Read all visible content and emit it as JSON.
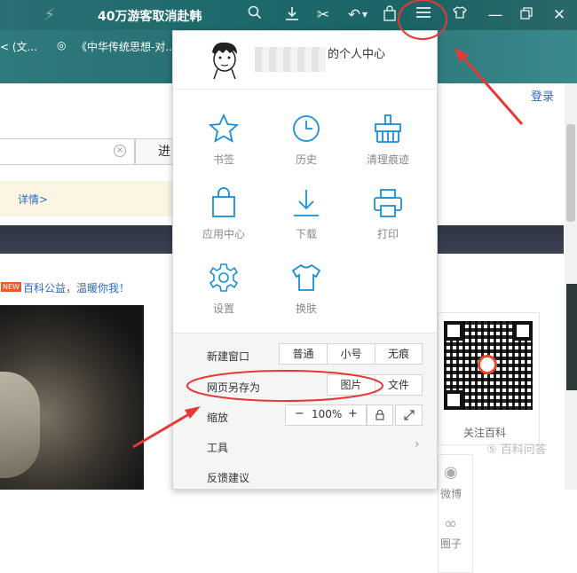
{
  "titlebar": {
    "title": "40万游客取消赴韩"
  },
  "bookmarks": [
    {
      "label": "< (文..."
    },
    {
      "label": "《中华传统思想-对..."
    }
  ],
  "page": {
    "login": "登录",
    "search_button": "进",
    "detail_link": "详情>",
    "new_badge": "NEW",
    "charity_text": "百科公益，温暖你我！",
    "follow_label": "关注百科",
    "side_items": [
      "微博",
      "圈子"
    ],
    "watermark": "⑤ 百科问答"
  },
  "menu": {
    "user_center_text": "的个人中心",
    "grid": [
      {
        "label": "书签",
        "icon": "star-icon"
      },
      {
        "label": "历史",
        "icon": "clock-icon"
      },
      {
        "label": "清理痕迹",
        "icon": "clean-icon"
      },
      {
        "label": "应用中心",
        "icon": "shopping-bag-icon"
      },
      {
        "label": "下载",
        "icon": "download-icon"
      },
      {
        "label": "打印",
        "icon": "printer-icon"
      },
      {
        "label": "设置",
        "icon": "gear-icon"
      },
      {
        "label": "换肤",
        "icon": "tshirt-icon"
      }
    ],
    "new_window": {
      "label": "新建窗口",
      "options": [
        "普通",
        "小号",
        "无痕"
      ]
    },
    "save_as": {
      "label": "网页另存为",
      "options": [
        "图片",
        "文件"
      ]
    },
    "zoom": {
      "label": "缩放",
      "minus": "−",
      "value": "100%",
      "plus": "+"
    },
    "tools": {
      "label": "工具"
    },
    "feedback": {
      "label": "反馈建议"
    }
  },
  "colors": {
    "accent": "#1a8fd6",
    "annotation": "#e53935",
    "titlebar": "#1d6a6b"
  }
}
